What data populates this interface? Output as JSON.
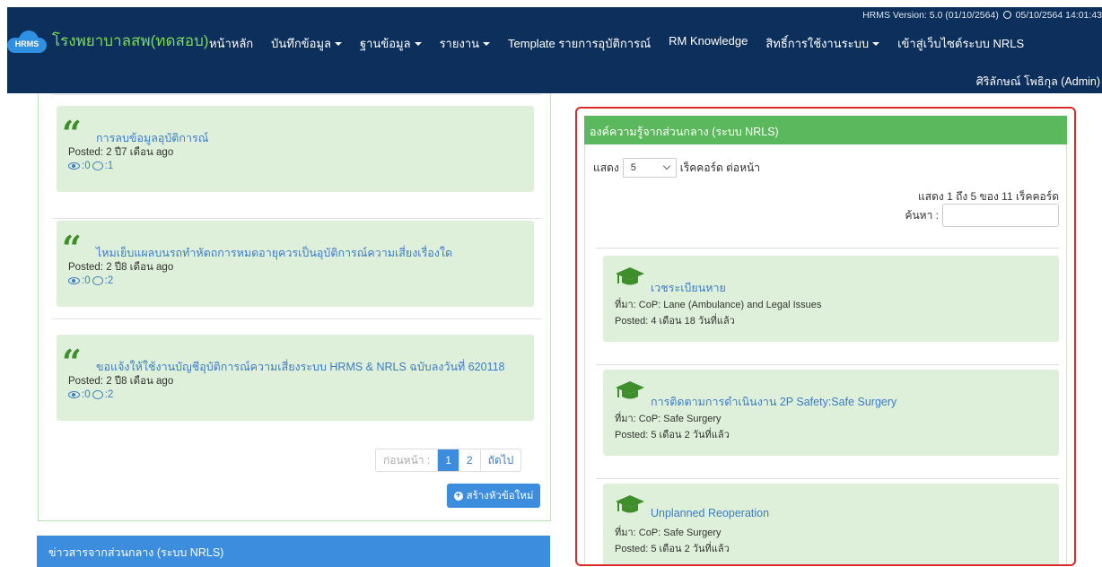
{
  "header": {
    "version_text": "HRMS Version: 5.0 (01/10/2564)",
    "datetime": "05/10/2564 14:01:43",
    "logo_text": "HRMS",
    "brand": "โรงพยาบาลสพ(ทดสอบ)",
    "menu": [
      {
        "label": "หน้าหลัก",
        "dropdown": false
      },
      {
        "label": "บันทึกข้อมูล",
        "dropdown": true
      },
      {
        "label": "ฐานข้อมูล",
        "dropdown": true
      },
      {
        "label": "รายงาน",
        "dropdown": true
      },
      {
        "label": "Template รายการอุบัติการณ์",
        "dropdown": false
      },
      {
        "label": "RM Knowledge",
        "dropdown": false
      },
      {
        "label": "สิทธิ์การใช้งานระบบ",
        "dropdown": true
      },
      {
        "label": "เข้าสู่เว็บไซต์ระบบ NRLS",
        "dropdown": false
      }
    ],
    "user": "ศิริลักษณ์ โพธิกุล (Admin)"
  },
  "topics": [
    {
      "title": "การลบข้อมูลอุบัติการณ์",
      "posted": "Posted: 2 ปี7 เดือน ago",
      "views": "0",
      "comments": "1"
    },
    {
      "title": "ไหมเย็บแผลบนรถทำหัตถการหมดอายุควรเป็นอุบัติการณ์ความเสี่ยงเรื่องใด",
      "posted": "Posted: 2 ปี8 เดือน ago",
      "views": "0",
      "comments": "2"
    },
    {
      "title": "ขอแจ้งให้ใช้งานบัญชีอุบัติการณ์ความเสี่ยงระบบ HRMS & NRLS ฉบับลงวันที่ 620118",
      "posted": "Posted: 2 ปี8 เดือน ago",
      "views": "0",
      "comments": "2"
    }
  ],
  "pagination": {
    "prev": "ก่อนหน้า :",
    "pages": [
      "1",
      "2"
    ],
    "active": "1",
    "next": "ถัดไป"
  },
  "new_topic_label": "สร้างหัวข้อใหม่",
  "news_header": "ข่าวสารจากส่วนกลาง (ระบบ NRLS)",
  "knowledge": {
    "header": "องค์ความรู้จากส่วนกลาง (ระบบ NRLS)",
    "show_label": "แสดง",
    "page_size": "5",
    "per_page_label": "เร็คคอร์ด ต่อหน้า",
    "info": "แสดง 1 ถึง 5 ของ 11 เร็คคอร์ด",
    "search_label": "ค้นหา :",
    "search_value": "",
    "items": [
      {
        "title": "เวชระเบียนหาย",
        "source": "ที่มา: CoP: Lane (Ambulance) and Legal Issues",
        "posted": "Posted: 4 เดือน 18 วันที่แล้ว"
      },
      {
        "title": "การติดตามการดำเนินงาน 2P Safety:Safe Surgery",
        "source": "ที่มา: CoP: Safe Surgery",
        "posted": "Posted: 5 เดือน 2 วันที่แล้ว"
      },
      {
        "title": "Unplanned Reoperation",
        "source": "ที่มา: CoP: Safe Surgery",
        "posted": "Posted: 5 เดือน 2 วันที่แล้ว"
      }
    ]
  },
  "colors": {
    "navbar": "#0d2f5c",
    "brand": "#7ed957",
    "card": "#def0d9",
    "link": "#3d7cc6",
    "primary": "#3c8dde",
    "success": "#5cb85c",
    "highlight": "#d92b2b"
  }
}
